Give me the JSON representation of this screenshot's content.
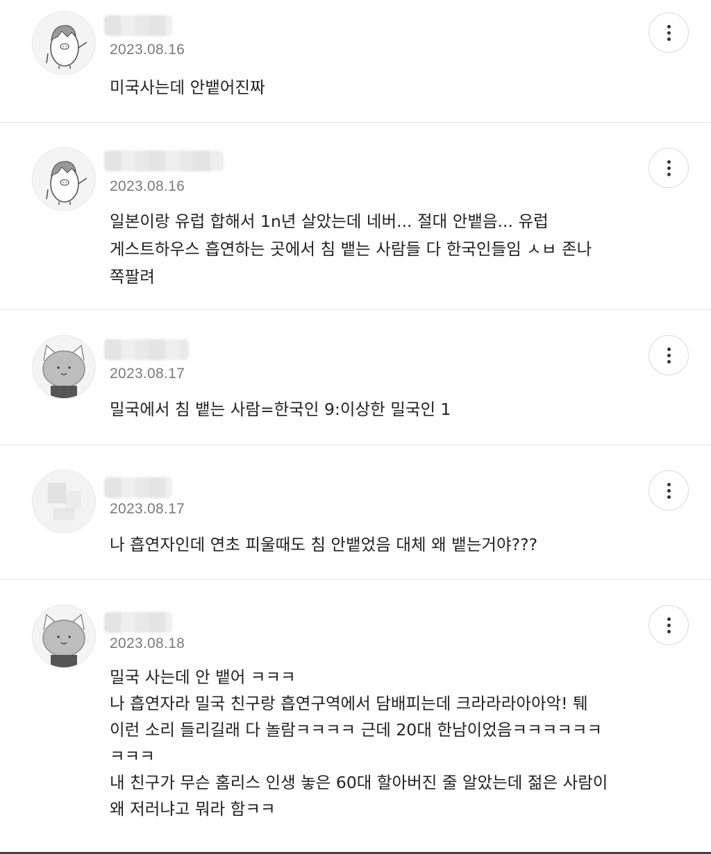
{
  "comments": [
    {
      "date": "2023.08.16",
      "text": "미국사는데 안뱉어진짜",
      "avatar_icon": "pig-character-icon"
    },
    {
      "date": "2023.08.16",
      "text": "일본이랑 유럽 합해서 1n년 살았는데 네버... 절대 안뱉음... 유럽\n게스트하우스 흡연하는 곳에서 침 뱉는 사람들 다 한국인들임 ㅅㅂ 존나\n쪽팔려",
      "avatar_icon": "pig-character-icon"
    },
    {
      "date": "2023.08.17",
      "text": "밀국에서 침 뱉는 사람=한국인 9:이상한 밀국인 1",
      "avatar_icon": "cat-character-icon"
    },
    {
      "date": "2023.08.17",
      "text": "나 흡연자인데 연초 피울때도 침 안뱉었음 대체 왜 뱉는거야???",
      "avatar_icon": "blurred-avatar-icon"
    },
    {
      "date": "2023.08.18",
      "text": "밀국 사는데 안 뱉어 ㅋㅋㅋ\n나 흡연자라 밀국 친구랑 흡연구역에서 담배피는데 크라라라아아악! 퉤\n이런 소리 들리길래 다 놀람ㅋㅋㅋㅋ 근데 20대 한남이었음ㅋㅋㅋㅋㅋㅋ\nㅋㅋㅋ\n내 친구가 무슨 홈리스 인생 놓은 60대 할아버진 줄 알았는데 젊은 사람이\n왜 저러냐고 뭐라 함ㅋㅋ",
      "avatar_icon": "cat-character-icon"
    }
  ]
}
